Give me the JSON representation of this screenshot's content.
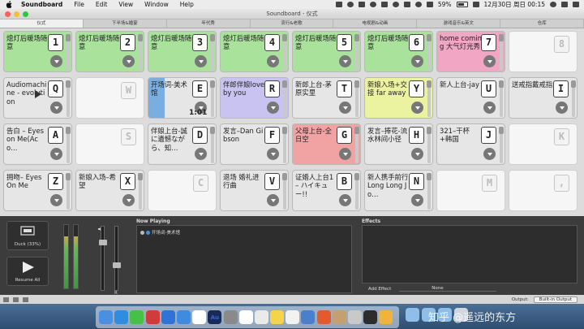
{
  "menubar": {
    "app": "Soundboard",
    "menus": [
      "File",
      "Edit",
      "View",
      "Window",
      "Help"
    ],
    "battery": "59%",
    "datetime": "12月30日 周日  00:15"
  },
  "window": {
    "title": "Soundboard - 仪式"
  },
  "tabs": [
    "仪式",
    "下半场&婚宴",
    "年代秀",
    "流行&老歌",
    "电视剧&动画",
    "游戏音乐&英文",
    "仓库"
  ],
  "buttons": [
    {
      "title": "熄灯后暖场随意",
      "key": "1",
      "color": "#a9e29b",
      "empty": false
    },
    {
      "title": "熄灯后暖场随意",
      "key": "2",
      "color": "#a9e29b",
      "empty": false
    },
    {
      "title": "熄灯后暖场随意",
      "key": "3",
      "color": "#a9e29b",
      "empty": false
    },
    {
      "title": "熄灯后暖场随意",
      "key": "4",
      "color": "#a9e29b",
      "empty": false
    },
    {
      "title": "熄灯后暖场随意",
      "key": "5",
      "color": "#a9e29b",
      "empty": false
    },
    {
      "title": "熄灯后暖场随意",
      "key": "6",
      "color": "#a9e29b",
      "empty": false
    },
    {
      "title": "home coming 大气灯光秀",
      "key": "7",
      "color": "#f1a6c4",
      "empty": false
    },
    {
      "title": "",
      "key": "8",
      "color": "#f6f6f6",
      "empty": true
    },
    {
      "title": "Audiomachine - evolution",
      "key": "Q",
      "color": "#e6e6e6",
      "empty": false
    },
    {
      "title": "",
      "key": "W",
      "color": "#f6f6f6",
      "empty": true
    },
    {
      "title": "开场词-美术馆",
      "key": "E",
      "color": "#e6e6e6",
      "empty": false,
      "playing": true,
      "time": "1:01"
    },
    {
      "title": "伴郎伴娘love by you",
      "key": "R",
      "color": "#c9c3f1",
      "empty": false
    },
    {
      "title": "新郎上台-茅原实里",
      "key": "T",
      "color": "#e6e6e6",
      "empty": false
    },
    {
      "title": "新娘入场+交接 far away",
      "key": "Y",
      "color": "#ecf3a0",
      "empty": false
    },
    {
      "title": "新人上台-jay",
      "key": "U",
      "color": "#e6e6e6",
      "empty": false
    },
    {
      "title": "送戒指戴戒指",
      "key": "I",
      "color": "#e6e6e6",
      "empty": false
    },
    {
      "title": "告白 – Eyes on Me(Aco…",
      "key": "A",
      "color": "#e6e6e6",
      "empty": false
    },
    {
      "title": "",
      "key": "S",
      "color": "#f6f6f6",
      "empty": true
    },
    {
      "title": "伴娘上台-誠に遺憾ながら、知…",
      "key": "D",
      "color": "#e6e6e6",
      "empty": false
    },
    {
      "title": "发言–Dan Gibson",
      "key": "F",
      "color": "#e6e6e6",
      "empty": false
    },
    {
      "title": "父母上台-全日空",
      "key": "G",
      "color": "#f1a3a3",
      "empty": false
    },
    {
      "title": "发言–捧花-流水林间小径",
      "key": "H",
      "color": "#e6e6e6",
      "empty": false
    },
    {
      "title": "321–干杯+韩国",
      "key": "J",
      "color": "#e6e6e6",
      "empty": false
    },
    {
      "title": "",
      "key": "K",
      "color": "#f6f6f6",
      "empty": true
    },
    {
      "title": "拥吻– Eyes On Me",
      "key": "Z",
      "color": "#e6e6e6",
      "empty": false
    },
    {
      "title": "新娘入场–希望",
      "key": "X",
      "color": "#e6e6e6",
      "empty": false
    },
    {
      "title": "",
      "key": "C",
      "color": "#f6f6f6",
      "empty": true
    },
    {
      "title": "退场 婚礼进行曲",
      "key": "V",
      "color": "#e6e6e6",
      "empty": false
    },
    {
      "title": "证婚人上台1 – ハイキュー!!",
      "key": "B",
      "color": "#e6e6e6",
      "empty": false
    },
    {
      "title": "新人携手前行 Long Long Jo…",
      "key": "N",
      "color": "#e6e6e6",
      "empty": false
    },
    {
      "title": "",
      "key": "M",
      "color": "#f6f6f6",
      "empty": true
    },
    {
      "title": "",
      "key": ",",
      "color": "#f6f6f6",
      "empty": true
    }
  ],
  "controls": {
    "duck": "Duck (33%)",
    "resume": "Resume All",
    "left": "L",
    "right": "R"
  },
  "now_playing": {
    "header": "Now Playing",
    "items": [
      "开场词-美术馆"
    ]
  },
  "effects": {
    "header": "Effects",
    "add_effect": "Add Effect",
    "effect_value": "None"
  },
  "status": {
    "output_label": "Output:",
    "output_value": "Built-in Output"
  },
  "dock": {
    "icons": [
      "finder-icon",
      "safari-icon",
      "wechat-icon",
      "netease-music-icon",
      "k-icon",
      "feather-icon",
      "multi-circle-icon",
      "audition-icon",
      "settings-icon",
      "chrome-icon",
      "cloud-icon",
      "notes-icon",
      "calendar-icon",
      "soundboard-icon",
      "media-player-icon",
      "camera-icon",
      "preview-icon",
      "music-icon",
      "qq-icon"
    ],
    "colors": [
      "#4a90e2",
      "#2e8de0",
      "#48c048",
      "#d23b3b",
      "#2f73d9",
      "#3e8ce0",
      "#ffffff",
      "#1a2a57",
      "#8a8a8a",
      "#ffffff",
      "#eaeaea",
      "#f6d44a",
      "#f2f2f2",
      "#4a7fd0",
      "#e35a2b",
      "#c4a070",
      "#c9c9c9",
      "#2d2d2d",
      "#f0b43a"
    ]
  },
  "watermark": "知乎 @遥远的东方"
}
